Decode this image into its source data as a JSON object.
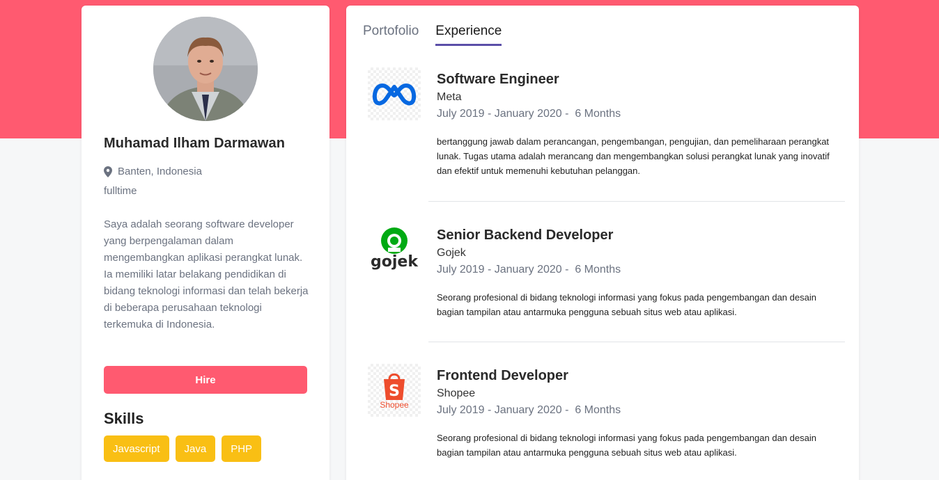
{
  "profile": {
    "name": "Muhamad Ilham Darmawan",
    "location": "Banten, Indonesia",
    "work_type": "fulltime",
    "bio": "Saya adalah seorang software developer yang berpengalaman dalam mengembangkan aplikasi perangkat lunak. Ia memiliki latar belakang pendidikan di bidang teknologi informasi dan telah bekerja di beberapa perusahaan teknologi terkemuka di Indonesia.",
    "hire_label": "Hire",
    "skills_title": "Skills",
    "skills": [
      "Javascript",
      "Java",
      "PHP"
    ]
  },
  "tabs": [
    {
      "label": "Portofolio",
      "active": false
    },
    {
      "label": "Experience",
      "active": true
    }
  ],
  "experiences": [
    {
      "title": "Software Engineer",
      "company": "Meta",
      "period": "July 2019 - January 2020 -  6 Months",
      "description": "bertanggung jawab dalam perancangan, pengembangan, pengujian, dan pemeliharaan perangkat lunak. Tugas utama adalah merancang dan mengembangkan solusi perangkat lunak yang inovatif dan efektif untuk memenuhi kebutuhan pelanggan.",
      "logo_icon": "meta-logo-icon"
    },
    {
      "title": "Senior Backend Developer",
      "company": "Gojek",
      "period": "July 2019 - January 2020 -  6 Months",
      "description": "Seorang profesional di bidang teknologi informasi yang fokus pada pengembangan dan desain bagian tampilan atau antarmuka pengguna sebuah situs web atau aplikasi.",
      "logo_icon": "gojek-logo-icon",
      "logo_text": "gojek"
    },
    {
      "title": "Frontend Developer",
      "company": "Shopee",
      "period": "July 2019 - January 2020 -  6 Months",
      "description": "Seorang profesional di bidang teknologi informasi yang fokus pada pengembangan dan desain bagian tampilan atau antarmuka pengguna sebuah situs web atau aplikasi.",
      "logo_icon": "shopee-logo-icon",
      "logo_text": "Shopee"
    }
  ],
  "colors": {
    "primary": "#ff5a70",
    "skill": "#f9bf14",
    "tab_underline": "#5b4fa8",
    "meta_blue": "#0668e1",
    "gojek_green": "#00aa13",
    "shopee_orange": "#ee4d2d"
  }
}
